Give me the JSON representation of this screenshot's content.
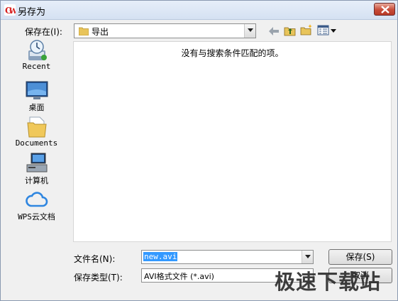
{
  "window": {
    "title": "另存为",
    "close_icon": "close-icon"
  },
  "location": {
    "label": "保存在(I):",
    "value": "导出",
    "folder_icon": "folder-icon"
  },
  "toolbar": {
    "back_icon": "back-arrow-icon",
    "up_icon": "up-folder-icon",
    "new_folder_icon": "new-folder-icon",
    "view_icon": "view-menu-icon"
  },
  "places": [
    {
      "label": "Recent",
      "icon": "recent-icon"
    },
    {
      "label": "桌面",
      "icon": "desktop-icon"
    },
    {
      "label": "Documents",
      "icon": "documents-icon"
    },
    {
      "label": "计算机",
      "icon": "computer-icon"
    },
    {
      "label": "WPS云文档",
      "icon": "cloud-icon"
    }
  ],
  "file_list": {
    "empty_message": "没有与搜索条件匹配的项。"
  },
  "filename": {
    "label": "文件名(N):",
    "value": "new.avi"
  },
  "filetype": {
    "label": "保存类型(T):",
    "value": "AVI格式文件 (*.avi)"
  },
  "buttons": {
    "save": "保存(S)",
    "cancel": "取消"
  },
  "watermark": {
    "text": "极速下载站"
  },
  "colors": {
    "accent": "#3399ff",
    "close": "#c74b38"
  }
}
